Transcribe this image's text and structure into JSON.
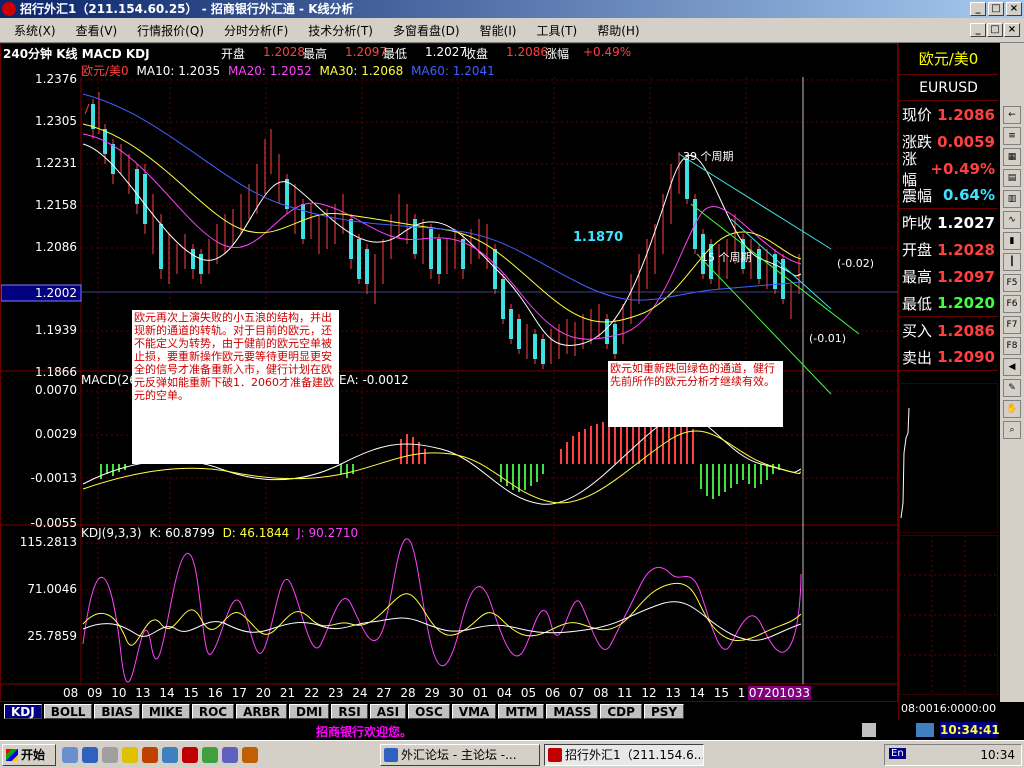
{
  "window": {
    "title": "招行外汇1（211.154.60.25） - 招商银行外汇通 - K线分析",
    "buttons": [
      "_",
      "□",
      "×"
    ]
  },
  "menu": [
    "系统(X)",
    "查看(V)",
    "行情报价(Q)",
    "分时分析(F)",
    "技术分析(T)",
    "多窗看盘(D)",
    "智能(I)",
    "工具(T)",
    "帮助(H)"
  ],
  "info": {
    "period": "240分钟 K线 MACD KDJ",
    "open_label": "开盘",
    "open": "1.2028",
    "high_label": "最高",
    "high": "1.2097",
    "low_label": "最低",
    "low": "1.2027",
    "close_label": "收盘",
    "close": "1.2086",
    "change_label": "涨幅",
    "change": "+0.49%"
  },
  "ma_legend": {
    "symbol": "欧元/美0",
    "ma10": "MA10: 1.2035",
    "ma20": "MA20: 1.2052",
    "ma30": "MA30: 1.2068",
    "ma60": "MA60: 1.2041"
  },
  "price_axis": [
    "1.2376",
    "1.2305",
    "1.2231",
    "1.2158",
    "1.2086",
    "1.2002",
    "1.1939",
    "1.1866"
  ],
  "macd_legend": {
    "prefix": "MACD(26",
    "suffix": "EA: -0.0012"
  },
  "macd_axis": [
    "0.0070",
    "0.0029",
    "-0.0013",
    "-0.0055"
  ],
  "kdj_legend": {
    "name": "KDJ(9,3,3)",
    "k": "K: 60.8799",
    "d": "D: 46.1844",
    "j": "J: 90.2710"
  },
  "kdj_axis": [
    "115.2813",
    "71.0046",
    "25.7859"
  ],
  "date_axis": [
    "08",
    "09",
    "10",
    "13",
    "14",
    "15",
    "16",
    "17",
    "20",
    "21",
    "22",
    "23",
    "24",
    "27",
    "28",
    "29",
    "30",
    "01",
    "04",
    "05",
    "06",
    "07",
    "08",
    "11",
    "12",
    "13",
    "14",
    "15",
    "1"
  ],
  "date_current": "07201033",
  "annotations": {
    "level": "1.1870",
    "cycle39": "39 个周期",
    "cycle15": "15 个周期",
    "minus002": "(-0.02)",
    "minus001": "(-0.01)",
    "note_left": "欧元再次上演失败的小五浪的结构，并出现新的通道的转轨。对于目前的欧元，还不能定义为转势，由于健前的欧元空单被止损，要重新操作欧元要等待更明显更安全的信号才准备重新入市，健行计划在欧元反弹如能重新下破1．2060才准备建欧元的空单。",
    "note_right": "欧元如重新跌回绿色的通道，健行先前所作的欧元分析才继续有效。"
  },
  "tabs": [
    "KDJ",
    "BOLL",
    "BIAS",
    "MIKE",
    "ROC",
    "ARBR",
    "DMI",
    "RSI",
    "ASI",
    "OSC",
    "VMA",
    "MTM",
    "MASS",
    "CDP",
    "PSY"
  ],
  "ticker": "招商银行欢迎您。",
  "right_panel": {
    "title": "欧元/美0",
    "code": "EURUSD",
    "rows": [
      {
        "label": "现价",
        "value": "1.2086",
        "color": "#ff4040"
      },
      {
        "label": "涨跌",
        "value": "0.0059",
        "color": "#ff4040"
      },
      {
        "label": "涨幅",
        "value": "+0.49%",
        "color": "#ff4040"
      },
      {
        "label": "震幅",
        "value": "0.64%",
        "color": "#40e0ff"
      },
      {
        "label": "昨收",
        "value": "1.2027",
        "color": "#ffffff"
      },
      {
        "label": "开盘",
        "value": "1.2028",
        "color": "#ff4040"
      },
      {
        "label": "最高",
        "value": "1.2097",
        "color": "#ff4040"
      },
      {
        "label": "最低",
        "value": "1.2020",
        "color": "#40ff40"
      },
      {
        "label": "买入",
        "value": "1.2086",
        "color": "#ff4040"
      },
      {
        "label": "卖出",
        "value": "1.2090",
        "color": "#ff4040"
      }
    ],
    "time_axis": "08:0016:0000:00",
    "clock": "10:34:41"
  },
  "taskbar": {
    "start": "开始",
    "btn1": "外汇论坛 - 主论坛 -...",
    "btn2": "招行外汇1（211.154.6...",
    "clock": "10:34",
    "lang": "En"
  }
}
